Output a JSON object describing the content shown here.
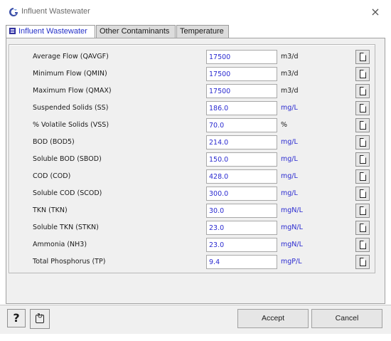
{
  "window": {
    "title": "Influent Wastewater",
    "close_glyph": "×"
  },
  "tabs": [
    {
      "label": "Influent Wastewater",
      "active": true
    },
    {
      "label": "Other Contaminants",
      "active": false
    },
    {
      "label": "Temperature",
      "active": false
    }
  ],
  "rows": [
    {
      "label": "Average Flow (QAVGF)",
      "value": "17500",
      "unit": "m3/d"
    },
    {
      "label": "Minimum Flow (QMIN)",
      "value": "17500",
      "unit": "m3/d"
    },
    {
      "label": "Maximum Flow (QMAX)",
      "value": "17500",
      "unit": "m3/d"
    },
    {
      "label": "Suspended Solids (SS)",
      "value": "186.0",
      "unit": "mg/L"
    },
    {
      "label": "% Volatile Solids (VSS)",
      "value": "70.0",
      "unit": "%"
    },
    {
      "label": "BOD (BOD5)",
      "value": "214.0",
      "unit": "mg/L"
    },
    {
      "label": "Soluble BOD (SBOD)",
      "value": "150.0",
      "unit": "mg/L"
    },
    {
      "label": "COD (COD)",
      "value": "428.0",
      "unit": "mg/L"
    },
    {
      "label": "Soluble COD (SCOD)",
      "value": "300.0",
      "unit": "mg/L"
    },
    {
      "label": "TKN (TKN)",
      "value": "30.0",
      "unit": "mgN/L"
    },
    {
      "label": "Soluble TKN (STKN)",
      "value": "23.0",
      "unit": "mgN/L"
    },
    {
      "label": "Ammonia (NH3)",
      "value": "23.0",
      "unit": "mgN/L"
    },
    {
      "label": "Total Phosphorus (TP)",
      "value": "9.4",
      "unit": "mgP/L"
    }
  ],
  "buttons": {
    "help": "?",
    "accept": "Accept",
    "cancel": "Cancel"
  },
  "colors": {
    "value_text": "#2a2ad0",
    "active_tab_text": "#2430c8"
  },
  "icons": {
    "app": "app-logo-icon",
    "tab": "form-icon",
    "row_button": "document-icon",
    "refresh": "refresh-icon"
  }
}
